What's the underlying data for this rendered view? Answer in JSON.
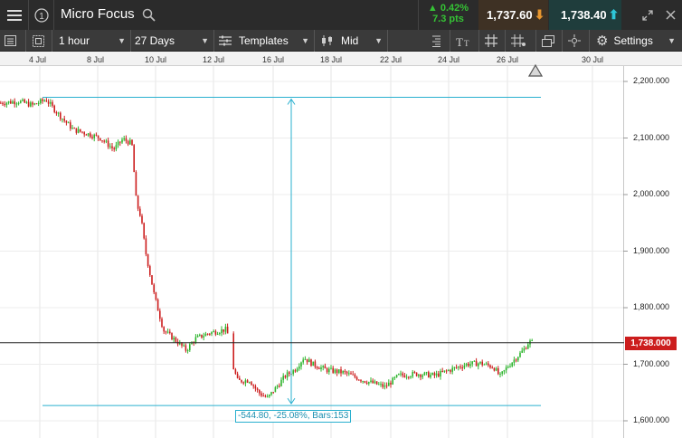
{
  "header": {
    "title": "Micro Focus",
    "change_pct": "▲ 0.42%",
    "change_pts": "7.3 pts",
    "sell_price": "1,737.60",
    "buy_price": "1,738.40",
    "colors": {
      "up": "#35c235",
      "sell_bg": "#3e3124",
      "buy_bg": "#1f3d3c"
    }
  },
  "toolbar": {
    "interval": "1 hour",
    "range": "27 Days",
    "templates": "Templates",
    "price_type": "Mid",
    "settings": "Settings"
  },
  "chart_data": {
    "type": "candlestick",
    "instrument": "Micro Focus",
    "x_tick_labels": [
      "4 Jul",
      "8 Jul",
      "10 Jul",
      "12 Jul",
      "16 Jul",
      "18 Jul",
      "22 Jul",
      "24 Jul",
      "26 Jul",
      "30 Jul"
    ],
    "y_tick_labels": [
      "2,200.000",
      "2,100.000",
      "2,000.000",
      "1,900.000",
      "1,800.000",
      "1,700.000",
      "1,600.000"
    ],
    "ylim": [
      1600,
      2200
    ],
    "current_price": 1738,
    "current_price_label": "1,738.000",
    "measurement": {
      "high": 2172,
      "low": 1627,
      "label": "-544.80, -25.08%, Bars:153"
    },
    "colors": {
      "up": "#2db52d",
      "down": "#cc1d1d",
      "tool": "#2ab0cf"
    }
  }
}
